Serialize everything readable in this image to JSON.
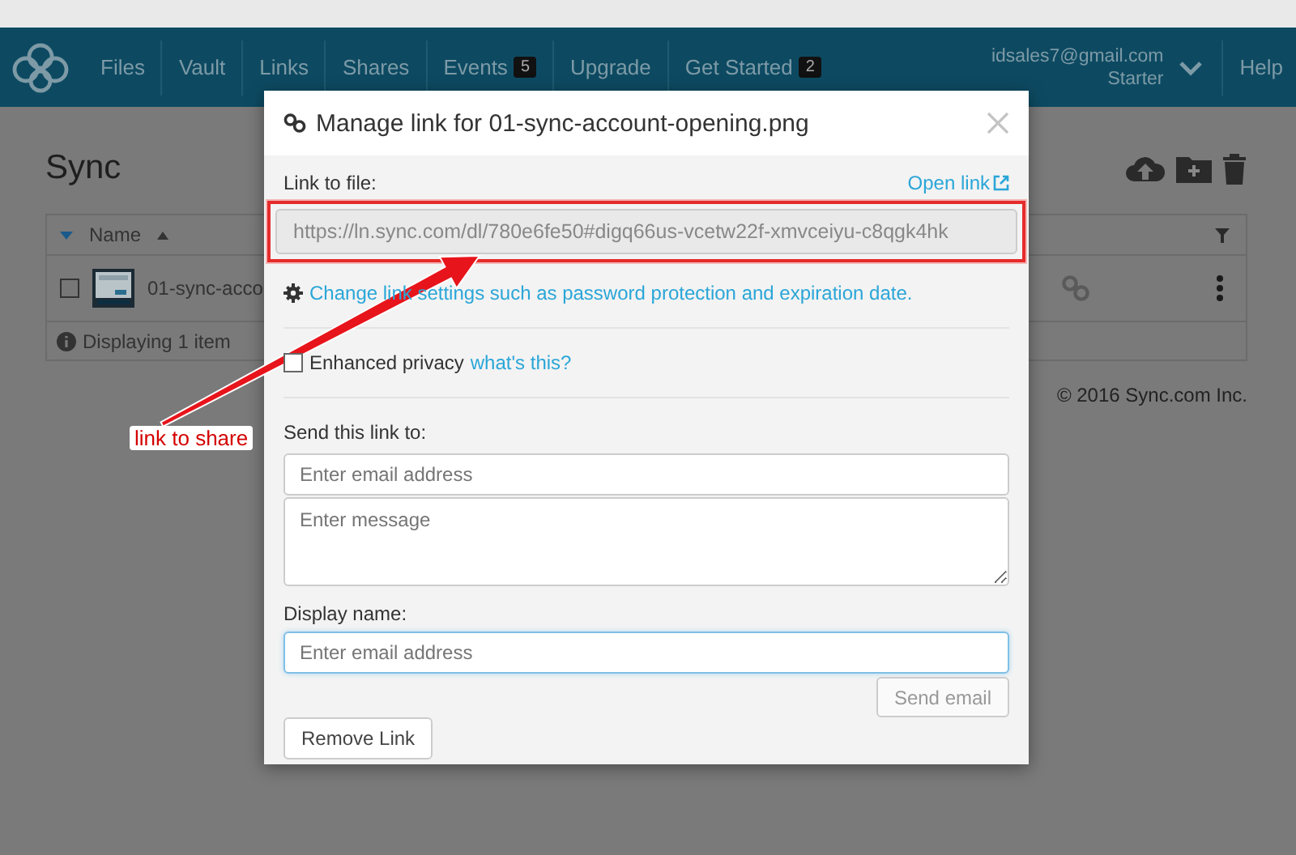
{
  "top_nav": {
    "items": [
      {
        "label": "Files"
      },
      {
        "label": "Vault"
      },
      {
        "label": "Links"
      },
      {
        "label": "Shares"
      },
      {
        "label": "Events",
        "badge": "5"
      },
      {
        "label": "Upgrade"
      },
      {
        "label": "Get Started",
        "badge": "2"
      }
    ],
    "account": {
      "email": "idsales7@gmail.com",
      "plan": "Starter"
    },
    "help": "Help"
  },
  "page": {
    "title": "Sync",
    "table": {
      "columns": [
        {
          "label": "Name"
        }
      ],
      "rows": [
        {
          "name": "01-sync-acco",
          "checked": false
        }
      ],
      "footer": "Displaying 1 item"
    },
    "copyright": "© 2016 Sync.com Inc."
  },
  "dialog": {
    "title": "Manage link for 01-sync-account-opening.png",
    "link_label": "Link to file:",
    "open_link": "Open link",
    "link_value": "https://ln.sync.com/dl/780e6fe50#digq66us-vcetw22f-xmvceiyu-c8qgk4hk",
    "settings_link": "Change link settings such as password protection and expiration date.",
    "privacy": {
      "label": "Enhanced privacy",
      "checked": false,
      "help_link": "what's this?"
    },
    "send_label": "Send this link to:",
    "email_placeholder": "Enter email address",
    "message_placeholder": "Enter message",
    "display_label": "Display name:",
    "display_placeholder": "Enter email address",
    "send_button": "Send email",
    "remove_button": "Remove Link"
  },
  "annotation": {
    "label": "link to share"
  }
}
